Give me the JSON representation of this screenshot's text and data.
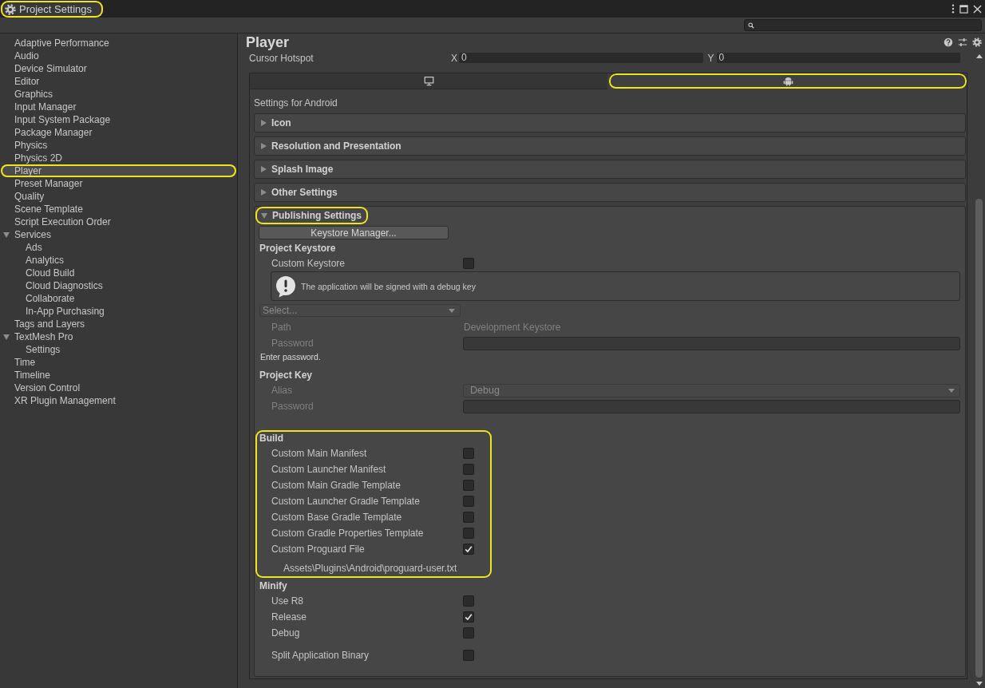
{
  "window": {
    "title": "Project Settings",
    "highlighted": true
  },
  "sidebar": {
    "items": [
      {
        "label": "Adaptive Performance",
        "selected": false,
        "highlighted": false
      },
      {
        "label": "Audio",
        "selected": false,
        "highlighted": false
      },
      {
        "label": "Device Simulator",
        "selected": false,
        "highlighted": false
      },
      {
        "label": "Editor",
        "selected": false,
        "highlighted": false
      },
      {
        "label": "Graphics",
        "selected": false,
        "highlighted": false
      },
      {
        "label": "Input Manager",
        "selected": false,
        "highlighted": false
      },
      {
        "label": "Input System Package",
        "selected": false,
        "highlighted": false
      },
      {
        "label": "Package Manager",
        "selected": false,
        "highlighted": false
      },
      {
        "label": "Physics",
        "selected": false,
        "highlighted": false
      },
      {
        "label": "Physics 2D",
        "selected": false,
        "highlighted": false
      },
      {
        "label": "Player",
        "selected": true,
        "highlighted": true
      },
      {
        "label": "Preset Manager",
        "selected": false,
        "highlighted": false
      },
      {
        "label": "Quality",
        "selected": false,
        "highlighted": false
      },
      {
        "label": "Scene Template",
        "selected": false,
        "highlighted": false
      },
      {
        "label": "Script Execution Order",
        "selected": false,
        "highlighted": false
      },
      {
        "label": "Services",
        "selected": false,
        "highlighted": false,
        "expanded": true,
        "children": [
          {
            "label": "Ads",
            "selected": false,
            "highlighted": false
          },
          {
            "label": "Analytics",
            "selected": false,
            "highlighted": false
          },
          {
            "label": "Cloud Build",
            "selected": false,
            "highlighted": false
          },
          {
            "label": "Cloud Diagnostics",
            "selected": false,
            "highlighted": false
          },
          {
            "label": "Collaborate",
            "selected": false,
            "highlighted": false
          },
          {
            "label": "In-App Purchasing",
            "selected": false,
            "highlighted": false
          }
        ]
      },
      {
        "label": "Tags and Layers",
        "selected": false,
        "highlighted": false
      },
      {
        "label": "TextMesh Pro",
        "selected": false,
        "highlighted": false,
        "expanded": true,
        "children": [
          {
            "label": "Settings",
            "selected": false,
            "highlighted": false
          }
        ]
      },
      {
        "label": "Time",
        "selected": false,
        "highlighted": false
      },
      {
        "label": "Timeline",
        "selected": false,
        "highlighted": false
      },
      {
        "label": "Version Control",
        "selected": false,
        "highlighted": false
      },
      {
        "label": "XR Plugin Management",
        "selected": false,
        "highlighted": false
      }
    ]
  },
  "inspector": {
    "title": "Player",
    "cursor_hotspot": {
      "label": "Cursor Hotspot",
      "x_label": "X",
      "x_value": "0",
      "y_label": "Y",
      "y_value": "0"
    },
    "platform_tabs": [
      {
        "kind": "desktop",
        "selected": false,
        "highlighted": false
      },
      {
        "kind": "android",
        "selected": true,
        "highlighted": true
      }
    ],
    "caption": "Settings for Android",
    "sections": [
      {
        "title": "Icon",
        "expanded": false,
        "highlighted": false
      },
      {
        "title": "Resolution and Presentation",
        "expanded": false,
        "highlighted": false
      },
      {
        "title": "Splash Image",
        "expanded": false,
        "highlighted": false
      },
      {
        "title": "Other Settings",
        "expanded": false,
        "highlighted": false
      },
      {
        "title": "Publishing Settings",
        "expanded": true,
        "highlighted": true,
        "content": {
          "button": "Keystore Manager...",
          "project_keystore": {
            "title": "Project Keystore",
            "custom_keystore": {
              "label": "Custom Keystore",
              "checked": false
            },
            "message": "The application will be signed with a debug key",
            "select": {
              "value": "Select...",
              "disabled": true
            },
            "path": {
              "label": "Path",
              "value": "Development Keystore",
              "disabled": true
            },
            "password": {
              "label": "Password",
              "disabled": true
            },
            "hint": "Enter password."
          },
          "project_key": {
            "title": "Project Key",
            "alias": {
              "label": "Alias",
              "value": "Debug",
              "disabled": true
            },
            "password": {
              "label": "Password",
              "disabled": true
            }
          },
          "build": {
            "title": "Build",
            "highlighted": true,
            "options": [
              {
                "label": "Custom Main Manifest",
                "checked": false
              },
              {
                "label": "Custom Launcher Manifest",
                "checked": false
              },
              {
                "label": "Custom Main Gradle Template",
                "checked": false
              },
              {
                "label": "Custom Launcher Gradle Template",
                "checked": false
              },
              {
                "label": "Custom Base Gradle Template",
                "checked": false
              },
              {
                "label": "Custom Gradle Properties Template",
                "checked": false
              },
              {
                "label": "Custom Proguard File",
                "checked": true
              }
            ],
            "proguard_path": "Assets\\Plugins\\Android\\proguard-user.txt"
          },
          "minify": {
            "title": "Minify",
            "options": [
              {
                "label": "Use R8",
                "checked": false
              },
              {
                "label": "Release",
                "checked": true
              },
              {
                "label": "Debug",
                "checked": false
              }
            ]
          },
          "split_application_binary": {
            "label": "Split Application Binary",
            "checked": false
          }
        }
      }
    ]
  }
}
